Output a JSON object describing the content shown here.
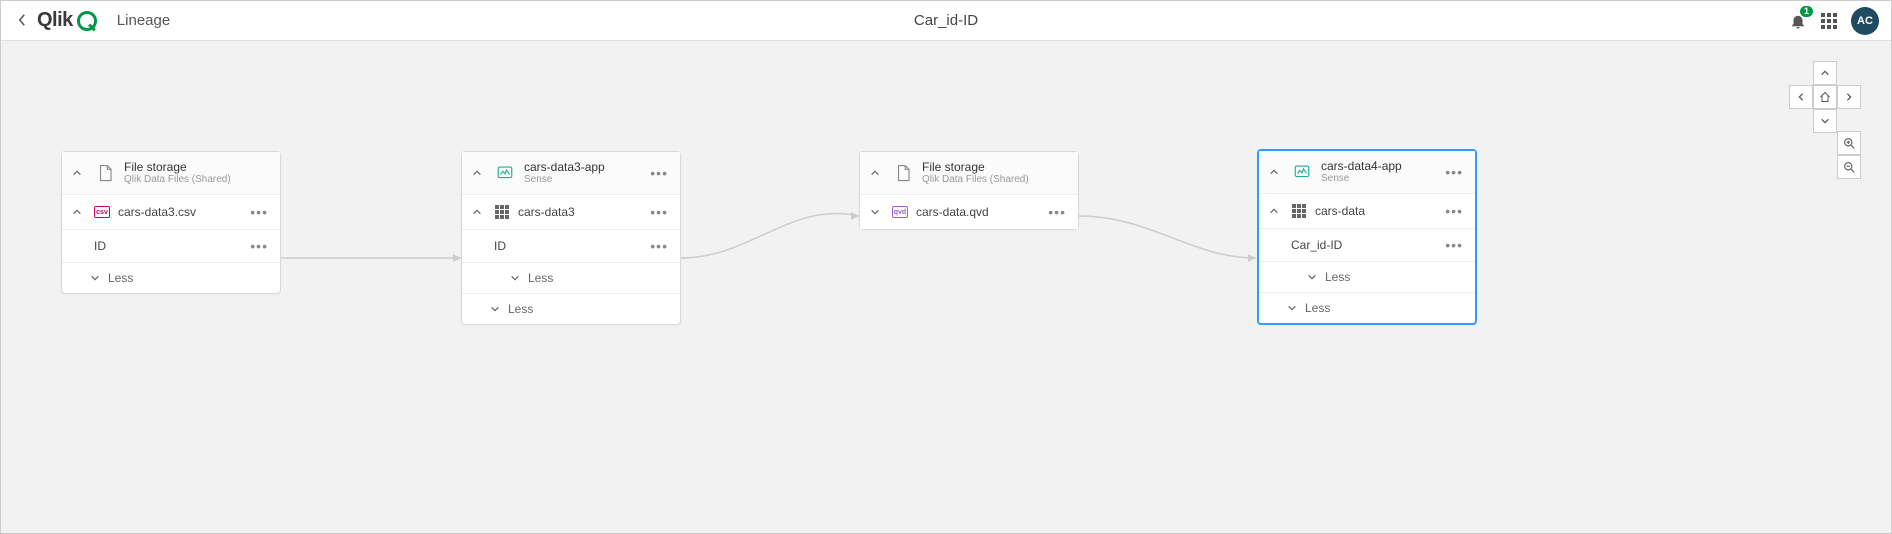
{
  "header": {
    "page_label": "Lineage",
    "center_title": "Car_id-ID",
    "notification_count": "1",
    "avatar_initials": "AC"
  },
  "less_label": "Less",
  "nodes": {
    "n1": {
      "title": "File storage",
      "subtitle": "Qlik Data Files (Shared)",
      "child_label": "cars-data3.csv",
      "child_badge": "csv",
      "field_label": "ID"
    },
    "n2": {
      "title": "cars-data3-app",
      "subtitle": "Sense",
      "child_label": "cars-data3",
      "field_label": "ID"
    },
    "n3": {
      "title": "File storage",
      "subtitle": "Qlik Data Files (Shared)",
      "child_label": "cars-data.qvd",
      "child_badge": "qvd"
    },
    "n4": {
      "title": "cars-data4-app",
      "subtitle": "Sense",
      "child_label": "cars-data",
      "field_label": "Car_id-ID"
    }
  }
}
